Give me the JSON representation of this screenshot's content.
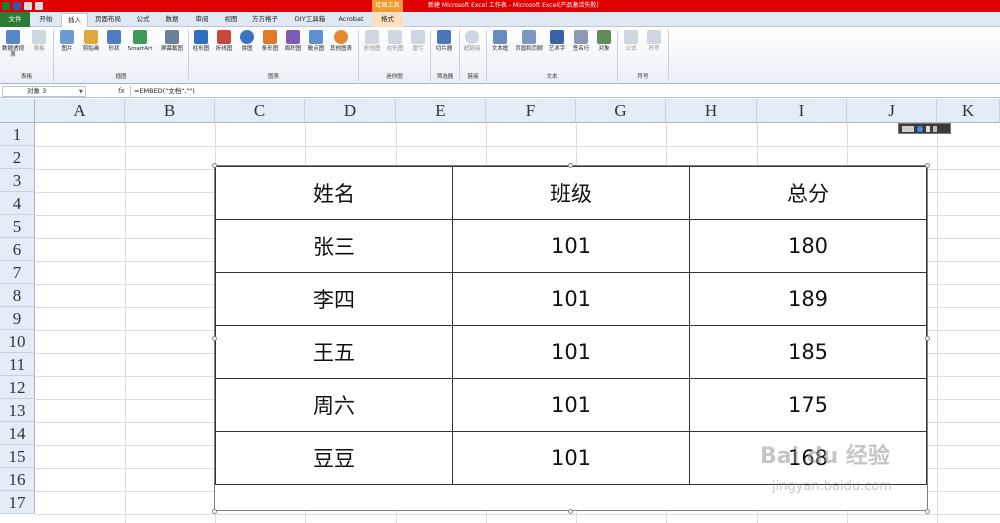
{
  "window": {
    "title": "新建 Microsoft Excel 工作表 - Microsoft Excel(产品激活失败)",
    "context_tool_title": "绘图工具"
  },
  "tabs": [
    "文件",
    "开始",
    "插入",
    "页面布局",
    "公式",
    "数据",
    "审阅",
    "视图",
    "方方格子",
    "DIY工具箱",
    "Acrobat",
    "格式"
  ],
  "ribbon": {
    "buttons": [
      "数据透视表",
      "表格",
      "图片",
      "剪贴画",
      "形状",
      "SmartArt",
      "屏幕截图",
      "柱形图",
      "折线图",
      "饼图",
      "条形图",
      "面积图",
      "散点图",
      "其他图表",
      "折线图",
      "柱形图",
      "盈亏",
      "切片器",
      "超链接",
      "文本框",
      "页眉和页脚",
      "艺术字",
      "签名行",
      "对象",
      "公式",
      "符号"
    ],
    "groups": [
      "表格",
      "插图",
      "图表",
      "迷你图",
      "筛选器",
      "链接",
      "文本",
      "符号"
    ]
  },
  "formula_bar": {
    "name_box": "对象 3",
    "fx": "fx",
    "formula": "=EMBED(\"文档\",\"\")"
  },
  "sheet": {
    "columns": [
      "A",
      "B",
      "C",
      "D",
      "E",
      "F",
      "G",
      "H",
      "I",
      "J",
      "K"
    ],
    "rows": [
      "1",
      "2",
      "3",
      "4",
      "5",
      "6",
      "7",
      "8",
      "9",
      "10",
      "11",
      "12",
      "13",
      "14",
      "15",
      "16",
      "17"
    ]
  },
  "embedded_table": {
    "headers": [
      "姓名",
      "班级",
      "总分"
    ],
    "rows": [
      [
        "张三",
        "101",
        "180"
      ],
      [
        "李四",
        "101",
        "189"
      ],
      [
        "王五",
        "101",
        "185"
      ],
      [
        "周六",
        "101",
        "175"
      ],
      [
        "豆豆",
        "101",
        "168"
      ]
    ]
  },
  "watermark": {
    "main": "Bai du 经验",
    "sub": "jingyan.baidu.com"
  }
}
